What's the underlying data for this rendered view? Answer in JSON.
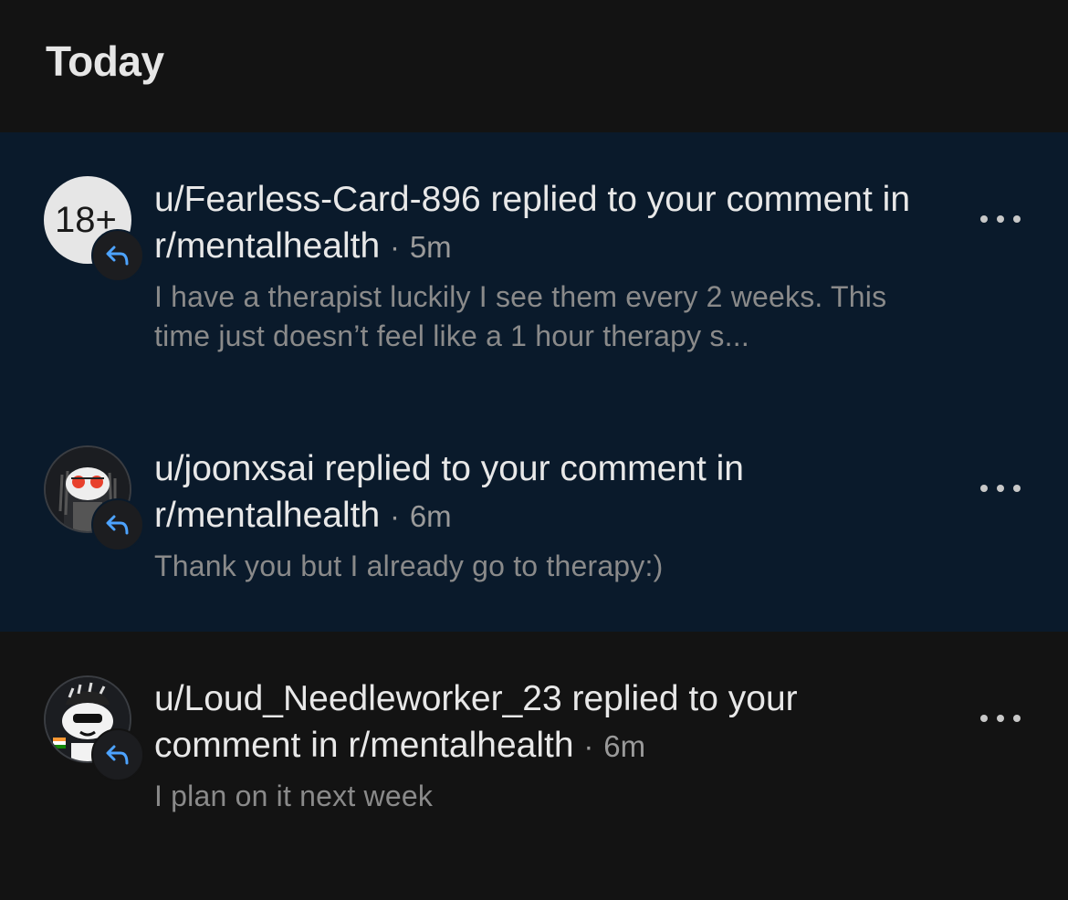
{
  "section": {
    "title": "Today"
  },
  "notifications": [
    {
      "headline_pre": "u/Fearless-Card-896 replied to your comment in r/mentalhealth",
      "time": "5m",
      "body": "I have a therapist luckily I see them every 2 weeks. This time just doesn’t feel like a 1 hour therapy s...",
      "avatar_text": "18+",
      "unread": true
    },
    {
      "headline_pre": "u/joonxsai replied to your comment in r/mentalhealth",
      "time": "6m",
      "body": "Thank you but I already go to therapy:)",
      "unread": true
    },
    {
      "headline_pre": "u/Loud_Needleworker_23 replied to your comment in r/mentalhealth",
      "time": "6m",
      "body": "I plan on it next week",
      "unread": false
    }
  ],
  "separator": "·",
  "icons": {
    "reply": "reply-arrow-icon",
    "more": "more-options-icon"
  },
  "colors": {
    "background": "#131313",
    "unread_background": "#0a1a2b",
    "reply_icon": "#4da3ff"
  }
}
